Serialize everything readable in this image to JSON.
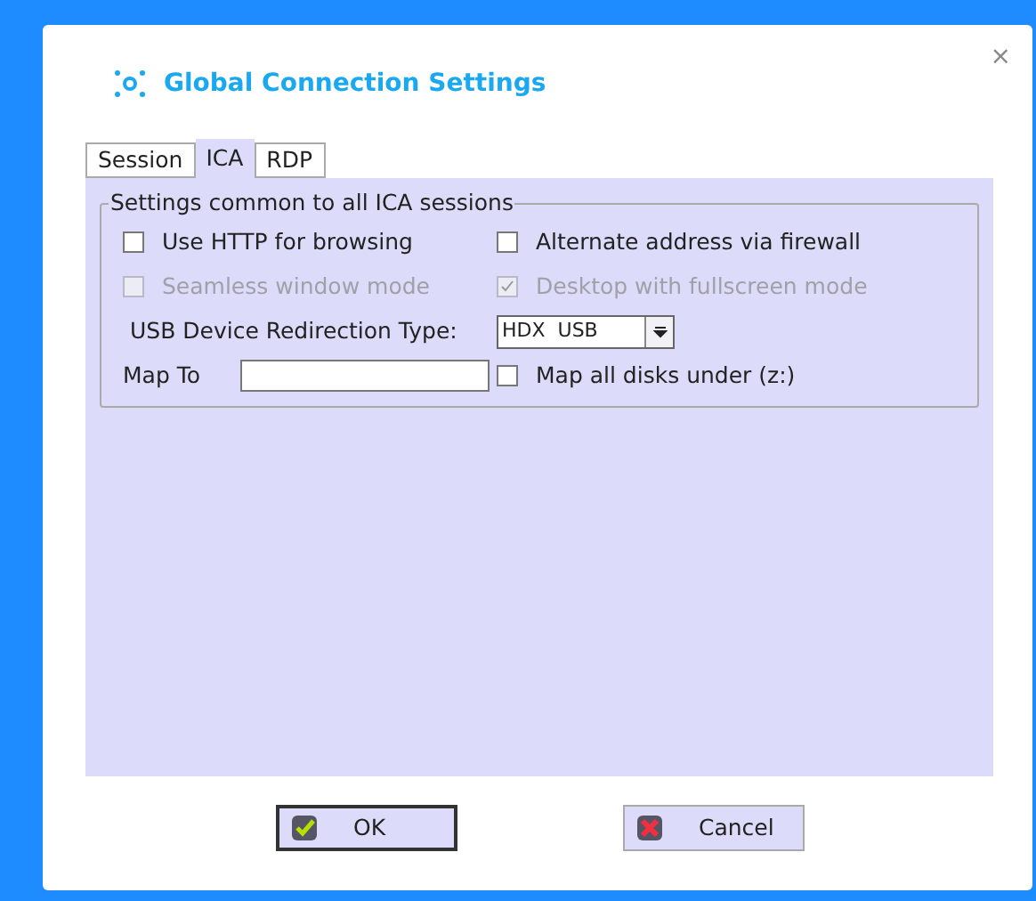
{
  "window": {
    "title": "Global Connection Settings",
    "close": "×"
  },
  "tabs": [
    {
      "label": "Session",
      "selected": false
    },
    {
      "label": "ICA",
      "selected": true
    },
    {
      "label": "RDP",
      "selected": false
    }
  ],
  "group": {
    "title": "Settings common to all ICA sessions",
    "rows": [
      [
        {
          "kind": "checkbox",
          "label": "Use HTTP for browsing",
          "checked": false,
          "disabled": false
        },
        {
          "kind": "checkbox",
          "label": "Alternate address via firewall",
          "checked": false,
          "disabled": false
        }
      ],
      [
        {
          "kind": "checkbox",
          "label": "Seamless window mode",
          "checked": false,
          "disabled": true
        },
        {
          "kind": "checkbox",
          "label": "Desktop with fullscreen mode",
          "checked": true,
          "disabled": true
        }
      ],
      [
        {
          "kind": "label",
          "label": "USB Device Redirection Type:"
        },
        {
          "kind": "select",
          "value": "HDX  USB"
        }
      ],
      [
        {
          "kind": "input",
          "label": "Map To"
        },
        {
          "kind": "checkbox",
          "label": "Map all disks under (z:)",
          "checked": false,
          "disabled": false
        }
      ]
    ]
  },
  "buttons": [
    {
      "label": "OK",
      "kind": "ok",
      "focused": true
    },
    {
      "label": "Cancel",
      "kind": "cancel",
      "focused": false
    }
  ]
}
